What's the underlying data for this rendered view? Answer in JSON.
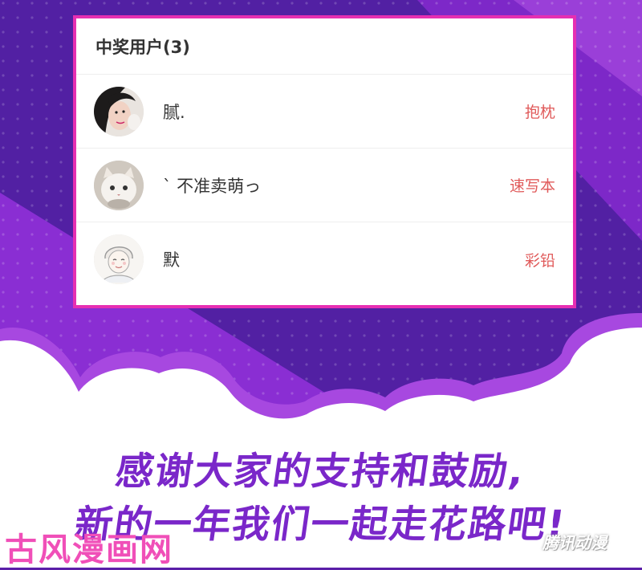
{
  "winners_panel": {
    "title": "中奖用户(3)",
    "winners": [
      {
        "name": "腻.",
        "prize": "抱枕",
        "avatar_icon": "girl-portrait-icon"
      },
      {
        "name": "ˋ 不准卖萌っ",
        "prize": "速写本",
        "avatar_icon": "white-cat-icon"
      },
      {
        "name": "默",
        "prize": "彩铅",
        "avatar_icon": "anime-girl-sketch-icon"
      }
    ]
  },
  "message": {
    "line1": "感谢大家的支持和鼓励,",
    "line2": "新的一年我们一起走花路吧!"
  },
  "watermarks": {
    "left": "古风漫画网",
    "right": "腾讯动漫"
  },
  "colors": {
    "background_purple": "#5b1fa8",
    "card_border": "#e62fb2",
    "prize_red": "#e05a5a",
    "headline_purple": "#7a27c9"
  }
}
